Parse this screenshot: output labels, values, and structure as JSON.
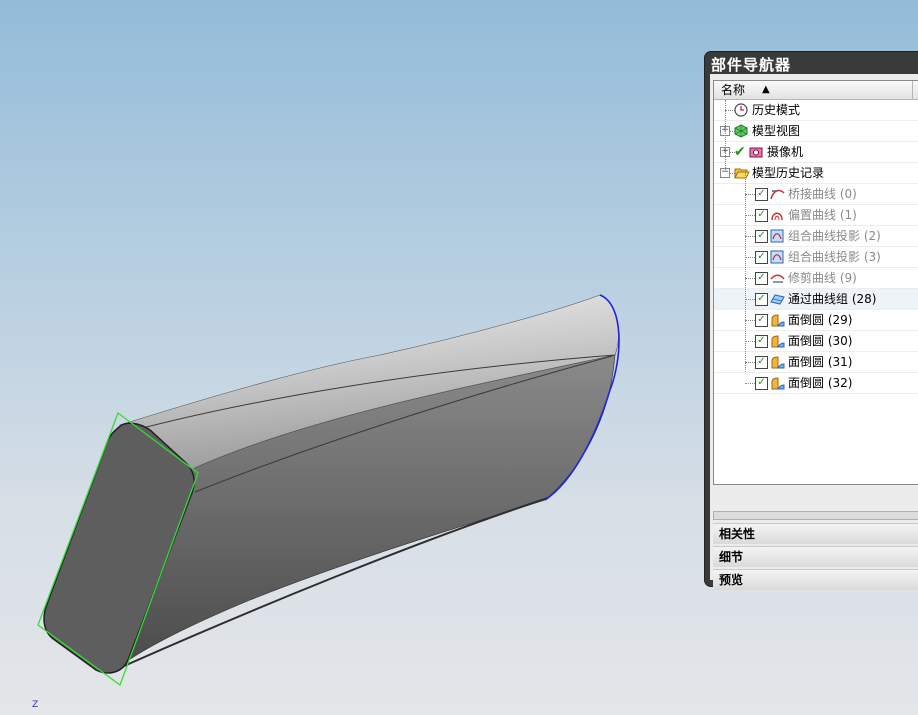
{
  "navigator": {
    "title": "部件导航器",
    "column_header": "名称",
    "sort_indicator": "▲",
    "tree": [
      {
        "label": "历史模式",
        "expander": "",
        "check": false,
        "icon": "clock-icon",
        "gray": false
      },
      {
        "label": "模型视图",
        "expander": "+",
        "check": false,
        "icon": "model-view-icon",
        "gray": false
      },
      {
        "label": "摄像机",
        "expander": "+",
        "check": true,
        "icon": "camera-icon",
        "gray": false
      },
      {
        "label": "模型历史记录",
        "expander": "−",
        "check": false,
        "icon": "folder-open-icon",
        "gray": false
      },
      {
        "label": "桥接曲线 (0)",
        "expander": "",
        "check": true,
        "icon": "bridge-curve-icon",
        "gray": true
      },
      {
        "label": "偏置曲线 (1)",
        "expander": "",
        "check": true,
        "icon": "offset-curve-icon",
        "gray": true
      },
      {
        "label": "组合曲线投影 (2)",
        "expander": "",
        "check": true,
        "icon": "combined-projection-icon",
        "gray": true
      },
      {
        "label": "组合曲线投影 (3)",
        "expander": "",
        "check": true,
        "icon": "combined-projection-icon",
        "gray": true
      },
      {
        "label": "修剪曲线 (9)",
        "expander": "",
        "check": true,
        "icon": "trim-curve-icon",
        "gray": true
      },
      {
        "label": "通过曲线组 (28)",
        "expander": "",
        "check": true,
        "icon": "through-curves-icon",
        "gray": false,
        "highlight": true
      },
      {
        "label": "面倒圆 (29)",
        "expander": "",
        "check": true,
        "icon": "face-blend-icon",
        "gray": false
      },
      {
        "label": "面倒圆 (30)",
        "expander": "",
        "check": true,
        "icon": "face-blend-icon",
        "gray": false
      },
      {
        "label": "面倒圆 (31)",
        "expander": "",
        "check": true,
        "icon": "face-blend-icon",
        "gray": false
      },
      {
        "label": "面倒圆 (32)",
        "expander": "",
        "check": true,
        "icon": "face-blend-icon",
        "gray": false
      }
    ],
    "sections": [
      "相关性",
      "细节",
      "预览"
    ]
  },
  "viewport": {
    "axis_label": "Z",
    "colors": {
      "background_top": "#93bcd9",
      "background_bottom": "#e4e6e9",
      "selected_edge": "#33dd33",
      "highlight_edge": "#2222dd",
      "body_shade": "#5e5e5e"
    }
  }
}
